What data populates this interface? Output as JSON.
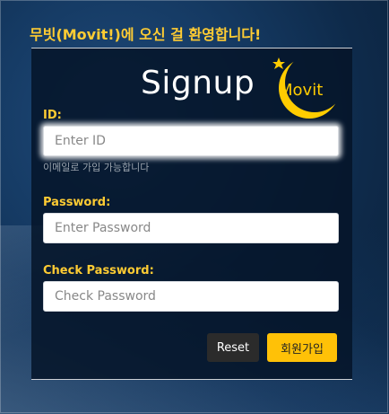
{
  "welcome": "무빗(Movit!)에 오신 걸 환영합니다!",
  "title": "Signup",
  "logo_text": "Movit",
  "fields": {
    "id": {
      "label": "ID:",
      "placeholder": "Enter ID",
      "hint": "이메일로 가입 가능합니다"
    },
    "password": {
      "label": "Password:",
      "placeholder": "Enter Password"
    },
    "check_password": {
      "label": "Check Password:",
      "placeholder": "Check Password"
    }
  },
  "buttons": {
    "reset": "Reset",
    "join": "회원가입"
  },
  "colors": {
    "accent": "#ffcc33",
    "join_button": "#ffc107",
    "reset_button": "#2b2b2b"
  },
  "icons": {
    "logo": "crescent-moon-star-icon"
  }
}
